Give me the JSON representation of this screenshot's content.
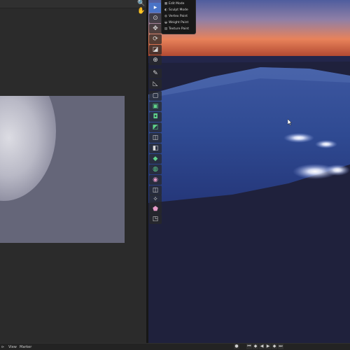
{
  "image_editor": {
    "header_icons": [
      {
        "name": "zoom-icon",
        "glyph": "🔍"
      },
      {
        "name": "hand-icon",
        "glyph": "✋"
      }
    ]
  },
  "toolbar": {
    "tools": [
      {
        "name": "select-tool",
        "glyph": "▸",
        "active": true
      },
      {
        "name": "cursor-tool",
        "glyph": "⊙"
      },
      {
        "name": "move-tool",
        "glyph": "✥"
      },
      {
        "name": "rotate-tool",
        "glyph": "⟳"
      },
      {
        "name": "scale-tool",
        "glyph": "◪"
      },
      {
        "name": "transform-tool",
        "glyph": "⊕"
      },
      {
        "name": "annotate-tool",
        "glyph": "✎"
      },
      {
        "name": "measure-tool",
        "glyph": "◺"
      },
      {
        "name": "add-cube-tool",
        "glyph": "▢"
      },
      {
        "name": "extrude-region-tool",
        "glyph": "▣",
        "color": "green"
      },
      {
        "name": "inset-faces-tool",
        "glyph": "◘",
        "color": "green"
      },
      {
        "name": "bevel-tool",
        "glyph": "◩",
        "color": "green"
      },
      {
        "name": "loop-cut-tool",
        "glyph": "◫"
      },
      {
        "name": "knife-tool",
        "glyph": "◧"
      },
      {
        "name": "poly-build-tool",
        "glyph": "◆",
        "color": "green"
      },
      {
        "name": "spin-tool",
        "glyph": "◍",
        "color": "green"
      },
      {
        "name": "smooth-tool",
        "glyph": "◉",
        "color": "pink"
      },
      {
        "name": "shrink-fatten-tool",
        "glyph": "◫"
      },
      {
        "name": "shear-tool",
        "glyph": "✧"
      },
      {
        "name": "rip-region-tool",
        "glyph": "⬟",
        "color": "pink"
      },
      {
        "name": "vertex-slide-tool",
        "glyph": "◳"
      }
    ]
  },
  "mode_menu": {
    "items": [
      {
        "label": "Edit Mode",
        "icon": "▦"
      },
      {
        "label": "Sculpt Mode",
        "icon": "◐"
      },
      {
        "label": "Vertex Paint",
        "icon": "◍"
      },
      {
        "label": "Weight Paint",
        "icon": "◒"
      },
      {
        "label": "Texture Paint",
        "icon": "▤"
      }
    ]
  },
  "status_bar": {
    "view_label": "View",
    "marker_label": "Marker",
    "left_glyph": "⊳"
  },
  "playback": {
    "buttons": [
      {
        "name": "record-button",
        "glyph": "●"
      },
      {
        "name": "jump-start-button",
        "glyph": "⏮"
      },
      {
        "name": "prev-keyframe-button",
        "glyph": "◆"
      },
      {
        "name": "play-reverse-button",
        "glyph": "◀"
      },
      {
        "name": "play-button",
        "glyph": "▶"
      },
      {
        "name": "next-keyframe-button",
        "glyph": "◆"
      },
      {
        "name": "jump-end-button",
        "glyph": "⏭"
      }
    ]
  },
  "colors": {
    "accent": "#4a73c6",
    "sky_top": "#5a69a8",
    "sky_glow": "#e4794f",
    "ground": "#1f213c",
    "image_canvas": "#656679"
  }
}
